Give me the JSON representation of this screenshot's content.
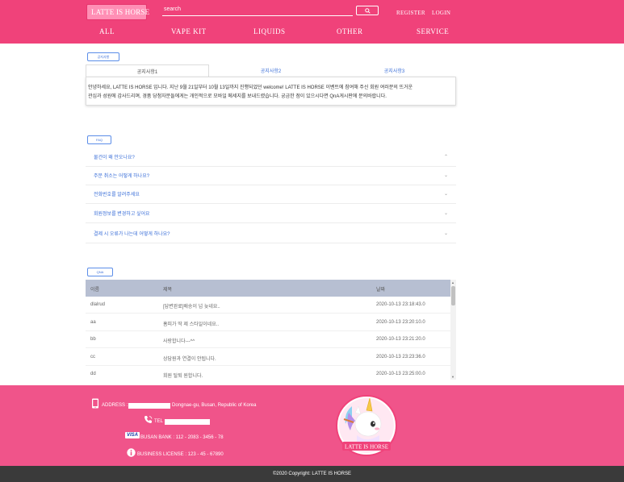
{
  "header": {
    "logo_text": "LATTE IS HORSE",
    "search_placeholder": "search",
    "register": "REGISTER",
    "login": "LOGIN",
    "nav": [
      "ALL",
      "VAPE KIT",
      "LIQUIDS",
      "OTHER",
      "SERVICE"
    ],
    "bg_color": "#f0427a"
  },
  "notice": {
    "section_label": "공지사항",
    "tabs": [
      "공지사항1",
      "공지사항2",
      "공지사항3"
    ],
    "line1": "안녕하세요, LATTE IS HORSE 입니다. 지난 9월 21일부터 10월 13일까지 진행되었던 welcome! LATTE IS HORSE 이벤트에 참여해 주신 회원 여러분의 뜨거운",
    "line2": "관심과 성원에 감사드리며, 경품 당첨자분들에게는 개인적으로 모바일 메세지를 보내드렸습니다. 궁금한 점이 있으시다면 QnA게시판에 문의바랍니다."
  },
  "faq": {
    "section_label": "FAQ",
    "items": [
      "물건이 왜 안오나요?",
      "주문 취소는 어떻게 하나요?",
      "전화번호를 알려주세요",
      "회원정보를 변경하고 싶어요",
      "결제 시 오류가 나는데 어떻게 하나요?"
    ]
  },
  "qna": {
    "section_label": "QNA",
    "headers": [
      "이름",
      "제목",
      "날짜"
    ],
    "rows": [
      {
        "name": "dlalrud",
        "title": "[답변완료]배송이 넘 늦네요..",
        "date": "2020-10-13 23:18:43.0"
      },
      {
        "name": "aa",
        "title": "홈피가 딱 제 스타일이네요..",
        "date": "2020-10-13 23:20:10.0"
      },
      {
        "name": "bb",
        "title": "사랑합니다---^^",
        "date": "2020-10-13 23:21:20.0"
      },
      {
        "name": "cc",
        "title": "상담원과 연결이 안됩니다.",
        "date": "2020-10-13 23:23:36.0"
      },
      {
        "name": "dd",
        "title": "회원 탈퇴 원합니다.",
        "date": "2020-10-13 23:25:00.0"
      }
    ]
  },
  "footer": {
    "address_label": "ADDRESS :",
    "address_value": "Dongnae-gu, Busan, Republic of Korea",
    "tel_label": "TEL :",
    "visa_label": "VISA",
    "bank": "BUSAN BANK : 112 - 2083 - 3456 - 78",
    "license": "BUSINESS LICENSE : 123 - 45 - 67890",
    "logo_text": "LATTE IS HORSE",
    "copyright": "©2020 Copyright: LATTE IS HORSE",
    "bg_color": "#f0548a"
  }
}
